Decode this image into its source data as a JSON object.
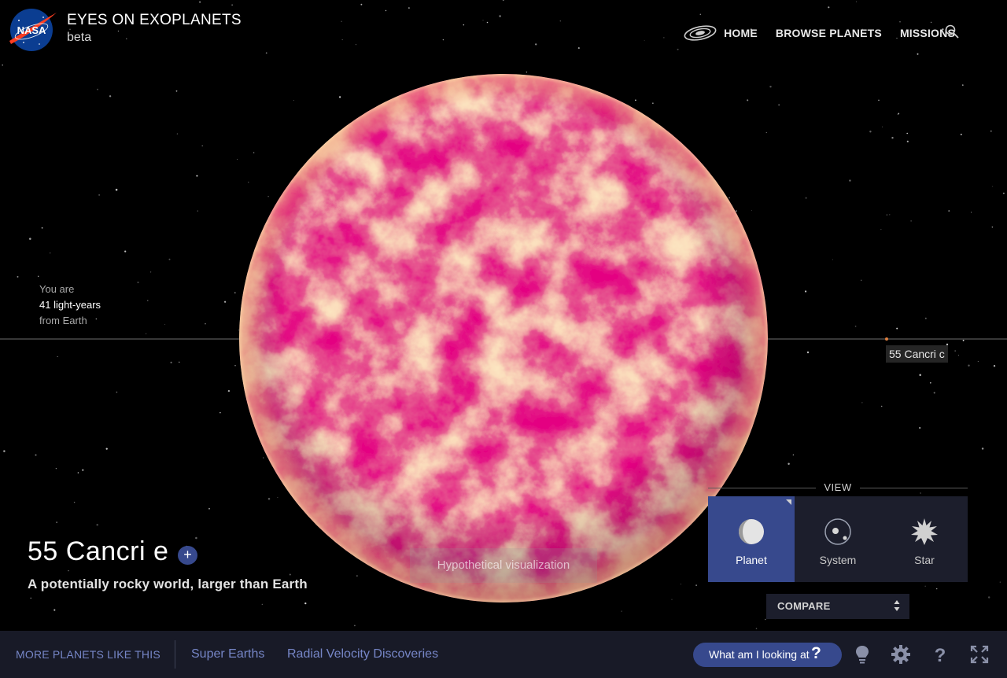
{
  "header": {
    "logo_text": "NASA",
    "title": "EYES ON EXOPLANETS",
    "subtitle": "beta",
    "nav": [
      {
        "label": "HOME"
      },
      {
        "label": "BROWSE PLANETS"
      },
      {
        "label": "MISSIONS"
      }
    ]
  },
  "distance": {
    "line1": "You are",
    "line2": "41 light-years",
    "line3": "from Earth"
  },
  "neighbor_label": "55 Cancri c",
  "planet": {
    "name": "55 Cancri e",
    "add_label": "+",
    "description": "A potentially rocky world, larger than Earth",
    "visualization_note": "Hypothetical visualization"
  },
  "view": {
    "title": "VIEW",
    "options": [
      {
        "label": "Planet",
        "icon": "planet-icon",
        "active": true
      },
      {
        "label": "System",
        "icon": "system-icon",
        "active": false
      },
      {
        "label": "Star",
        "icon": "star-icon",
        "active": false
      }
    ]
  },
  "compare_label": "COMPARE",
  "bottom": {
    "more_label": "MORE PLANETS LIKE THIS",
    "links": [
      "Super Earths",
      "Radial Velocity Discoveries"
    ],
    "what_label": "What am I looking at",
    "what_mark": "?"
  },
  "colors": {
    "accent": "#37498d",
    "bar_bg": "#181a27",
    "panel_bg": "#1c1e2c",
    "link": "#7686c7",
    "planet_dark": "#c8003c",
    "planet_light": "#f5c27a"
  }
}
